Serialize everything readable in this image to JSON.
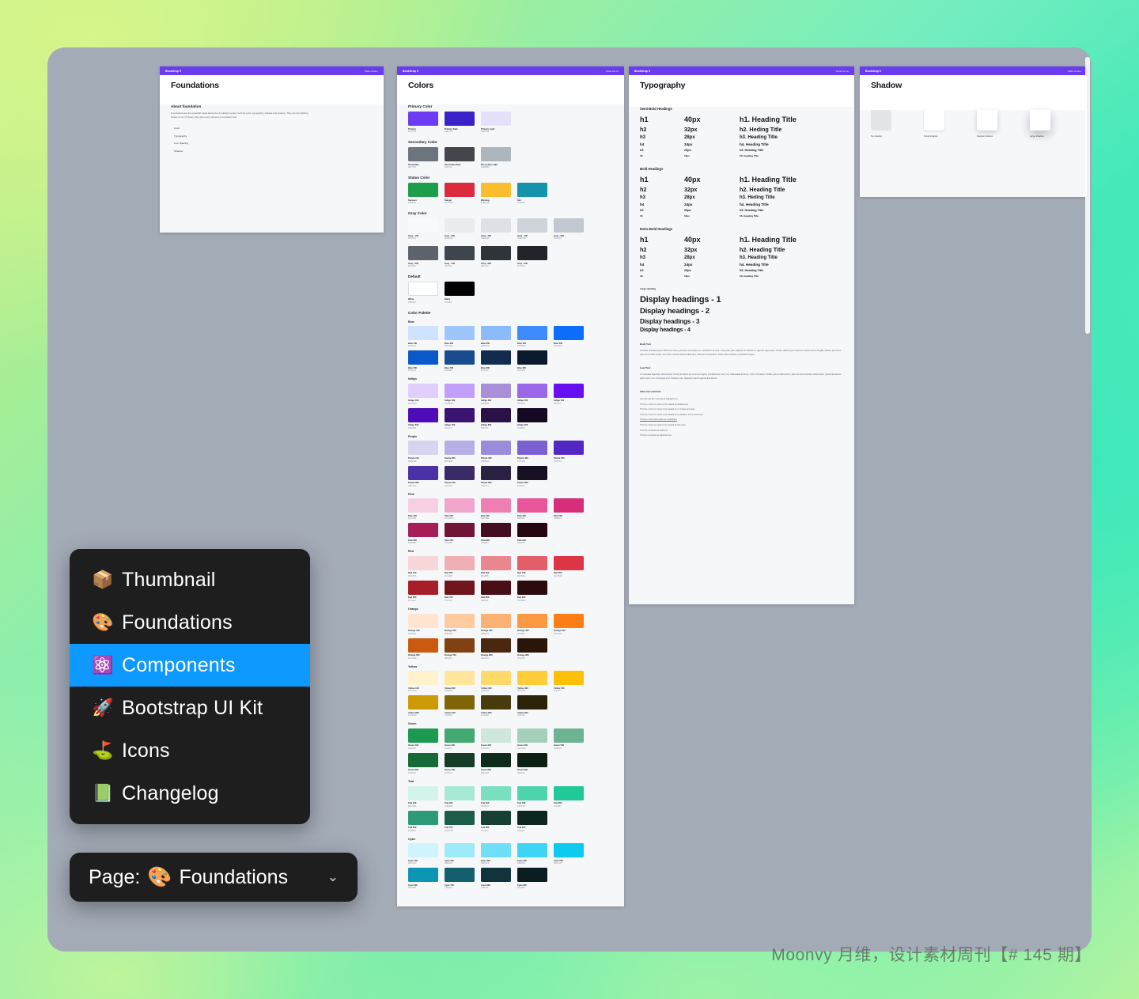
{
  "watermark": "Moonvy 月维，设计素材周刊【# 145 期】",
  "page_menu": {
    "items": [
      {
        "emoji": "📦",
        "label": "Thumbnail",
        "active": false
      },
      {
        "emoji": "🎨",
        "label": "Foundations",
        "active": false
      },
      {
        "emoji": "⚛️",
        "label": "Components",
        "active": true
      },
      {
        "emoji": "🚀",
        "label": "Bootstrap UI Kit",
        "active": false
      },
      {
        "emoji": "⛳",
        "label": "Icons",
        "active": false
      },
      {
        "emoji": "📗",
        "label": "Changelog",
        "active": false
      }
    ]
  },
  "page_select": {
    "prefix": "Page:",
    "emoji": "🎨",
    "value": "Foundations",
    "chevron": "⌄"
  },
  "boards": {
    "foundations": {
      "nav_brand": "Bootstrap 5",
      "nav_link": "Make Button",
      "title": "Foundations",
      "section_heading": "About foundation",
      "paragraph": "Foundations are the essential visual elements of a design system such as color, typography, shadow and spacing. They are the building blocks of our UI library, they give every element a consistent look.",
      "list": [
        "Color",
        "Typography",
        "Line Spacing",
        "Shadow"
      ]
    },
    "colors": {
      "nav_brand": "Bootstrap 5",
      "nav_link": "Scale Demo",
      "title": "Colors",
      "groups": [
        {
          "name": "Primary Color",
          "swatches": [
            {
              "name": "Primary",
              "value": "#6C3CF4",
              "hex": "#6C3CF4"
            },
            {
              "name": "Primary Dark",
              "value": "#3B21C9",
              "hex": "#3B21C9"
            },
            {
              "name": "Primary Light",
              "value": "#E6E1FB",
              "hex": "#E6E1FB"
            }
          ]
        },
        {
          "name": "Secondary Color",
          "swatches": [
            {
              "name": "Secondary",
              "value": "#6C757D",
              "hex": "#6C757D"
            },
            {
              "name": "Secondary Dark",
              "value": "#43474C",
              "hex": "#43474C"
            },
            {
              "name": "Secondary Light",
              "value": "#ADB5BD",
              "hex": "#ADB5BD"
            }
          ]
        },
        {
          "name": "Status Color",
          "swatches": [
            {
              "name": "Success",
              "value": "#1E9E4A",
              "hex": "#1E9E4A"
            },
            {
              "name": "Danger",
              "value": "#DC2B3C",
              "hex": "#DC2B3C"
            },
            {
              "name": "Warning",
              "value": "#FBBC2E",
              "hex": "#FBBC2E"
            },
            {
              "name": "Info",
              "value": "#1394AC",
              "hex": "#1394AC"
            }
          ]
        },
        {
          "name": "Gray Color",
          "swatches": [
            {
              "name": "Gray - 100",
              "value": "#F8F9FA",
              "hex": "#F8F9FA"
            },
            {
              "name": "Gray - 200",
              "value": "#E9ECEF",
              "hex": "#E9ECEF"
            },
            {
              "name": "Gray - 300",
              "value": "#DEE2E6",
              "hex": "#DEE2E6"
            },
            {
              "name": "Gray - 400",
              "value": "#CED4DA",
              "hex": "#CED4DA"
            },
            {
              "name": "Gray - 500",
              "value": "#C2C8CF",
              "hex": "#C2C8CF"
            },
            {
              "name": "Gray - 600",
              "value": "#5C636A",
              "hex": "#5C636A"
            },
            {
              "name": "Gray - 700",
              "value": "#3F454C",
              "hex": "#3F454C"
            },
            {
              "name": "Gray - 800",
              "value": "#2F343A",
              "hex": "#2F343A"
            },
            {
              "name": "Gray - 900",
              "value": "#212529",
              "hex": "#212529"
            }
          ]
        },
        {
          "name": "Default",
          "swatches": [
            {
              "name": "White",
              "value": "#FFFFFF",
              "hex": "#FFFFFF"
            },
            {
              "name": "Black",
              "value": "#000000",
              "hex": "#000000"
            }
          ]
        }
      ],
      "palette_heading": "Color Palette",
      "palettes": [
        {
          "name": "Blue",
          "steps": [
            "100",
            "200",
            "300",
            "400",
            "500",
            "600",
            "700",
            "800",
            "900"
          ],
          "colors": [
            "#CFE2FF",
            "#9EC5FE",
            "#8BBAFD",
            "#3D8BFD",
            "#0D6EFD",
            "#0A58CA",
            "#194B8E",
            "#122C4F",
            "#0A192C"
          ]
        },
        {
          "name": "Indigo",
          "steps": [
            "100",
            "200",
            "300",
            "400",
            "500",
            "600",
            "700",
            "800",
            "900"
          ],
          "colors": [
            "#E0CFFC",
            "#C29FFA",
            "#A98EDA",
            "#9A68E8",
            "#6610F2",
            "#4E0CB8",
            "#3A1471",
            "#2A1147",
            "#140823"
          ]
        },
        {
          "name": "Purple",
          "steps": [
            "100",
            "200",
            "300",
            "400",
            "500",
            "600",
            "700",
            "800",
            "900"
          ],
          "colors": [
            "#D8D3EE",
            "#B7AEE5",
            "#9B8BDA",
            "#7C61D4",
            "#5227C4",
            "#4B31A6",
            "#3A2A66",
            "#2A2143",
            "#170F22"
          ]
        },
        {
          "name": "Pink",
          "steps": [
            "100",
            "200",
            "300",
            "400",
            "500",
            "600",
            "700",
            "800",
            "900"
          ],
          "colors": [
            "#F6CFE3",
            "#F1A6CB",
            "#EE7FB2",
            "#E8559A",
            "#D62E7A",
            "#A61E58",
            "#701438",
            "#430E22",
            "#260711"
          ]
        },
        {
          "name": "Red",
          "steps": [
            "100",
            "200",
            "300",
            "400",
            "500",
            "600",
            "700",
            "800",
            "900"
          ],
          "colors": [
            "#F8D7DA",
            "#F1AEB5",
            "#EA868F",
            "#E35D6A",
            "#DC3545",
            "#A71E2A",
            "#71151D",
            "#481015",
            "#2C0B0E"
          ]
        },
        {
          "name": "Orange",
          "steps": [
            "100",
            "200",
            "300",
            "400",
            "500",
            "600",
            "700",
            "800",
            "900"
          ],
          "colors": [
            "#FFE5D0",
            "#FECBA1",
            "#FDB172",
            "#FD9843",
            "#FD7E14",
            "#CA5A0E",
            "#804213",
            "#4A2810",
            "#2A1609"
          ]
        },
        {
          "name": "Yellow",
          "steps": [
            "100",
            "200",
            "300",
            "400",
            "500",
            "600",
            "700",
            "800",
            "900"
          ],
          "colors": [
            "#FFF3CD",
            "#FFE69C",
            "#FFDA6A",
            "#FFCD39",
            "#FFC107",
            "#CC9A06",
            "#7D6508",
            "#473A0B",
            "#2B2208"
          ]
        },
        {
          "name": "Green",
          "steps": [
            "100",
            "200",
            "300",
            "400",
            "500",
            "600",
            "700",
            "800",
            "900"
          ],
          "colors": [
            "#1D9A52",
            "#44A872",
            "#CFE7DA",
            "#A3CFBB",
            "#6DB493",
            "#156A38",
            "#143C26",
            "#0E2A1B",
            "#0B1F12"
          ]
        },
        {
          "name": "Teal",
          "steps": [
            "100",
            "200",
            "300",
            "400",
            "500",
            "600",
            "700",
            "800",
            "900"
          ],
          "colors": [
            "#D2F4EA",
            "#A6E9D5",
            "#79DFC1",
            "#4DD4AC",
            "#20C997",
            "#2E9B78",
            "#1D5C4B",
            "#173F34",
            "#0E2620"
          ]
        },
        {
          "name": "Cyan",
          "steps": [
            "100",
            "200",
            "300",
            "400",
            "500",
            "600",
            "700",
            "800",
            "900"
          ],
          "colors": [
            "#CFF4FC",
            "#9EEAF9",
            "#6EDFF6",
            "#3DD5F3",
            "#0DCAF0",
            "#0C94B4",
            "#15606E",
            "#11333C",
            "#0A1E22"
          ]
        }
      ]
    },
    "typography": {
      "nav_brand": "Bootstrap 5",
      "nav_link": "Scale Demo",
      "title": "Typography",
      "sections": [
        {
          "name": "Semi-Bold Headings",
          "rows": [
            {
              "tag": "h1",
              "size": "40px",
              "sample": "h1. Heading Title"
            },
            {
              "tag": "h2",
              "size": "32px",
              "sample": "h2. Heding Title"
            },
            {
              "tag": "h3",
              "size": "28px",
              "sample": "h3. Heading Title"
            },
            {
              "tag": "h4",
              "size": "24px",
              "sample": "h4. Heading Title"
            },
            {
              "tag": "h5",
              "size": "20px",
              "sample": "h5. Heading Title"
            },
            {
              "tag": "h6",
              "size": "16px",
              "sample": "h6. Heading Title"
            }
          ]
        },
        {
          "name": "Bold Headings",
          "rows": [
            {
              "tag": "h1",
              "size": "40px",
              "sample": "h1. Heading Title"
            },
            {
              "tag": "h2",
              "size": "32px",
              "sample": "h2. Heading Title"
            },
            {
              "tag": "h3",
              "size": "28px",
              "sample": "h3. Heding Title"
            },
            {
              "tag": "h4",
              "size": "24px",
              "sample": "h4. Heading Title"
            },
            {
              "tag": "h5",
              "size": "20px",
              "sample": "h5. Heading Title"
            },
            {
              "tag": "h6",
              "size": "16px",
              "sample": "h6. Heading Title"
            }
          ]
        },
        {
          "name": "Extra-Bold Headings",
          "rows": [
            {
              "tag": "h1",
              "size": "40px",
              "sample": "h1. Heading Title"
            },
            {
              "tag": "h2",
              "size": "32px",
              "sample": "h2. Heading Title"
            },
            {
              "tag": "h3",
              "size": "28px",
              "sample": "h3. Heading Title"
            },
            {
              "tag": "h4",
              "size": "24px",
              "sample": "h4. Heading Title"
            },
            {
              "tag": "h5",
              "size": "20px",
              "sample": "h5. Heading Title"
            },
            {
              "tag": "h6",
              "size": "16px",
              "sample": "h6. Heading Title"
            }
          ]
        }
      ],
      "large_heading_label": "Large Heading",
      "displays": [
        "Display headings - 1",
        "Display headings - 2",
        "Display headings - 3",
        "Display headings - 4"
      ],
      "body_label": "Body Text",
      "body_text": "Curabitur blandit tempor. Morbi leo risus, porta ac consectetur ac, vestibulum at eros. Cras justo odio, dapibus ac facilisis in, egestas eget quam. Donec ullamcorper nulla non metus auctor fringilla. Nullam quis risus eget urna mollis ornare vel eu leo. Aenean lacinia bibendum nulla sed consectetur. Nulla vitae elit libero, a pharetra augue.",
      "lead_label": "Lead Text",
      "lead_text": "Ut vulputate dignissim ullamcorper. Donec tincidunt leo sit amet magna, condimentum sem non malesuada sit amet, rutrum id sapien. Nullam quis condimentum, justo sit amet tincidunt ullamcorper, ligula velit auctor justo turpis, nec consequat enim tristique quis. Quisque mauris eget lacinia lacinia.",
      "inline_label": "Inline text elements",
      "inline_items": [
        "You can use the mark tag to highlight text.",
        "This line of text is meant to be treated as deleted text.",
        "This line of text is meant to be treated as no longer accurate.",
        "This line of text is meant to be treated as an addition to the document.",
        "This line of text will render as underlined.",
        "This line of text is meant to be treated as fine print.",
        "This line rendered as bold text.",
        "This line rendered as italicized text."
      ]
    },
    "shadow": {
      "nav_brand": "Bootstrap 5",
      "nav_link": "Make Button",
      "title": "Shadow",
      "items": [
        {
          "label": "No shadow",
          "level": 0
        },
        {
          "label": "Small shadow",
          "level": 1
        },
        {
          "label": "Regular shadow",
          "level": 2
        },
        {
          "label": "Large shadow",
          "level": 3
        }
      ]
    }
  }
}
